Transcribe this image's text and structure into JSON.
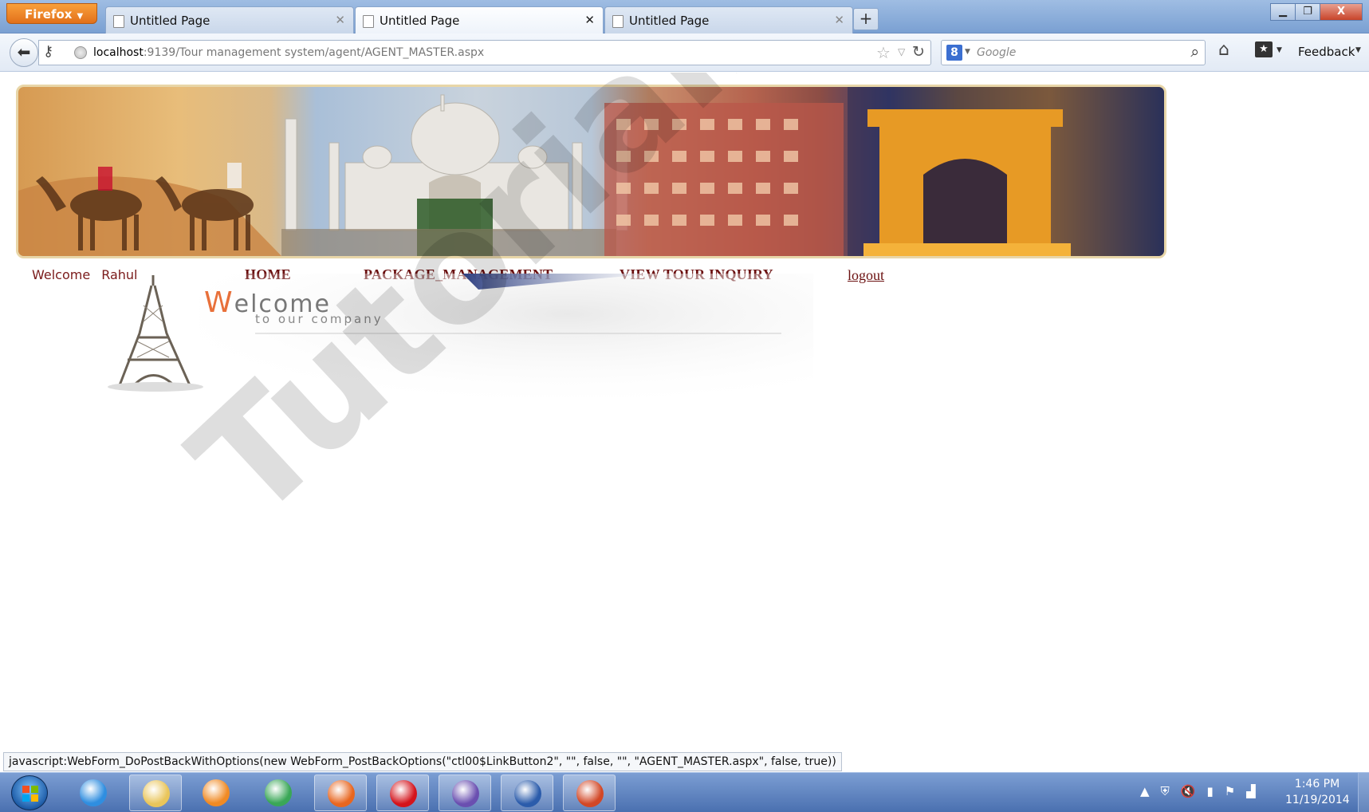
{
  "browser": {
    "menu_label": "Firefox",
    "tabs": [
      {
        "title": "Untitled Page",
        "active": false
      },
      {
        "title": "Untitled Page",
        "active": true
      },
      {
        "title": "Untitled Page",
        "active": false
      }
    ],
    "new_tab_label": "+",
    "window_controls": {
      "minimize": "▁",
      "maximize": "❐",
      "close": "X"
    },
    "url": {
      "host": "localhost",
      "rest": ":9139/Tour management system/agent/AGENT_MASTER.aspx"
    },
    "search": {
      "engine_label": "8",
      "placeholder": "Google"
    },
    "feedback_label": "Feedback"
  },
  "page": {
    "welcome_label": "Welcome",
    "user_name": "Rahul",
    "nav": [
      {
        "label": "HOME"
      },
      {
        "label": "PACKAGE_MANAGEMENT"
      },
      {
        "label": "VIEW TOUR INQUIRY"
      }
    ],
    "logout_label": "logout",
    "welcome_graphic": {
      "title_first": "W",
      "title_rest": "elcome",
      "subtitle": "to our company"
    }
  },
  "status_bar": {
    "text": "javascript:WebForm_DoPostBackWithOptions(new WebForm_PostBackOptions(\"ctl00$LinkButton2\", \"\", false, \"\", \"AGENT_MASTER.aspx\", false, true))"
  },
  "taskbar": {
    "items": [
      {
        "name": "internet-explorer-icon",
        "color": "#2f8ee0"
      },
      {
        "name": "file-explorer-icon",
        "color": "#e9c55a"
      },
      {
        "name": "media-player-icon",
        "color": "#f08a24"
      },
      {
        "name": "chrome-icon",
        "color": "#3aa757"
      },
      {
        "name": "firefox-icon",
        "color": "#e8661f"
      },
      {
        "name": "opera-icon",
        "color": "#d4141c"
      },
      {
        "name": "visual-studio-icon",
        "color": "#6a4fb0"
      },
      {
        "name": "word-icon",
        "color": "#2b5cab"
      },
      {
        "name": "powerpoint-icon",
        "color": "#d24726"
      }
    ],
    "clock": {
      "time": "1:46 PM",
      "date": "11/19/2014"
    }
  },
  "watermark": "TutorialsDuniya.com",
  "colors": {
    "link": "#6b1010",
    "accent": "#e8703a",
    "taskbar": "#4a70b0"
  }
}
